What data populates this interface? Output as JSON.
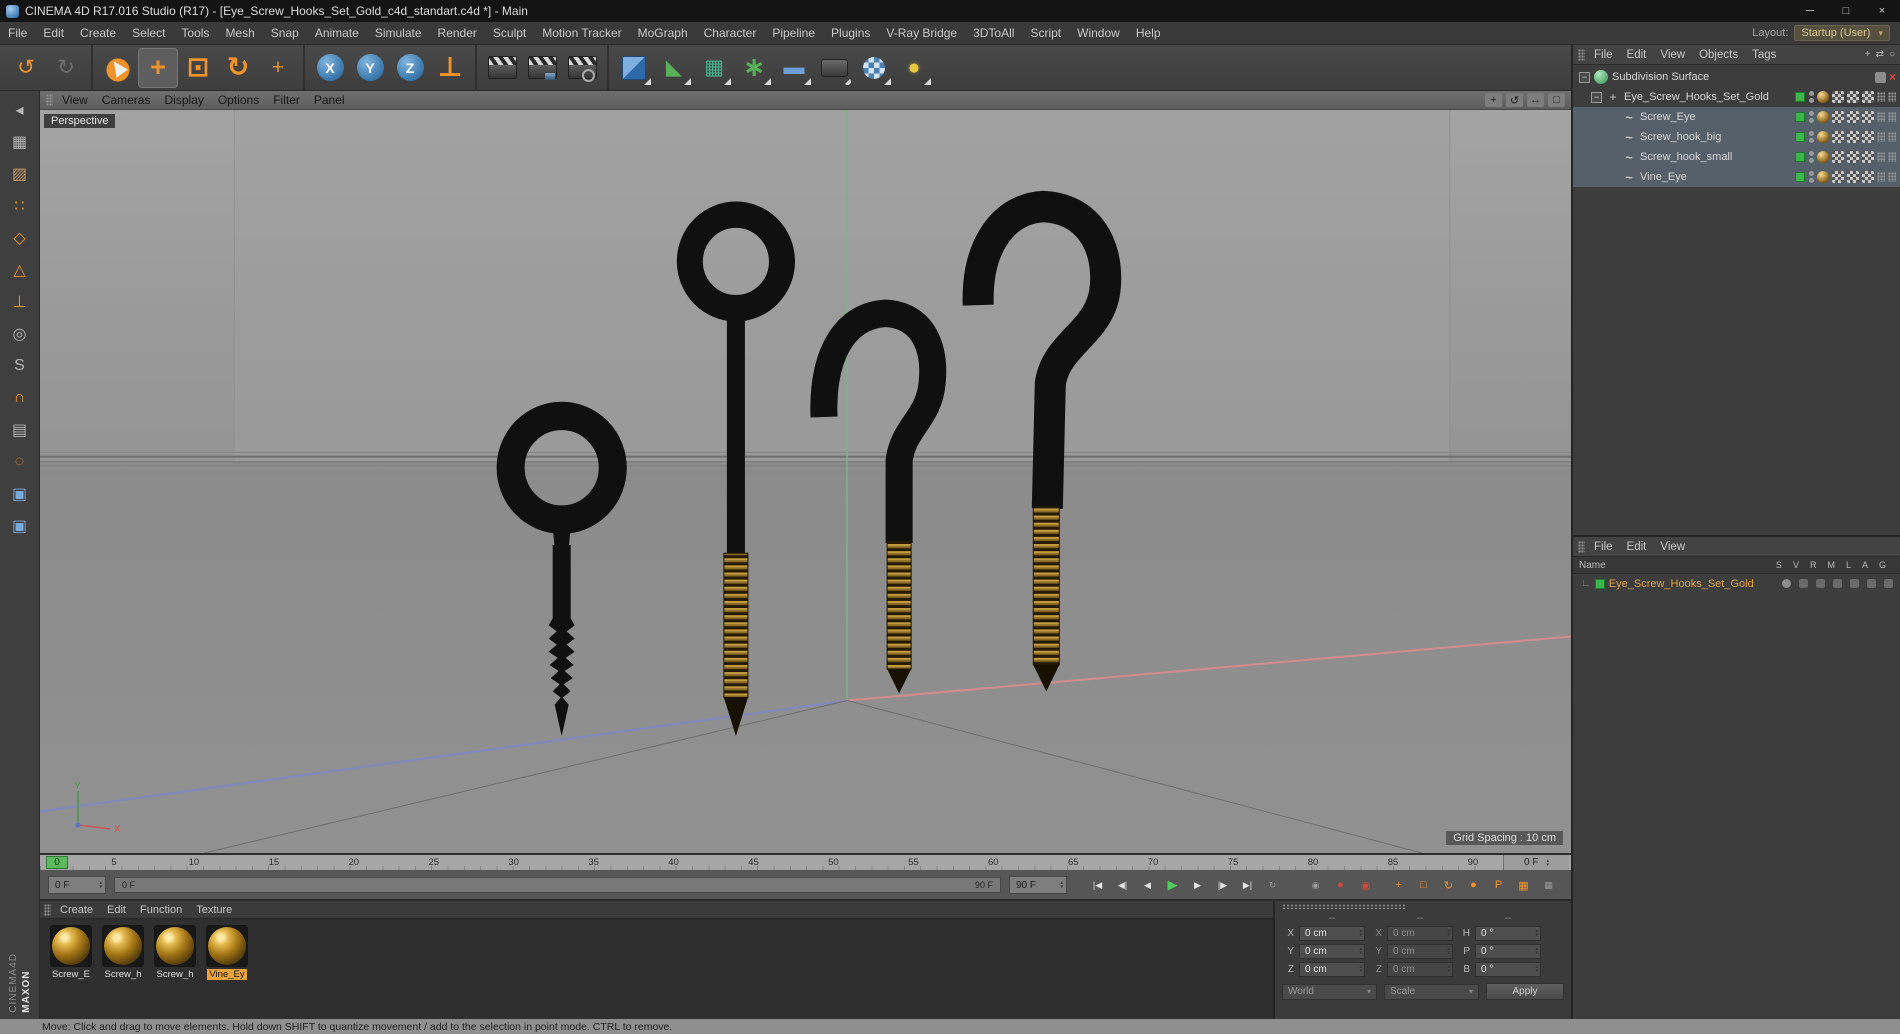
{
  "window": {
    "title": "CINEMA 4D R17.016 Studio (R17) - [Eye_Screw_Hooks_Set_Gold_c4d_standart.c4d *] - Main",
    "minimize": "─",
    "maximize": "□",
    "close": "×"
  },
  "menubar": {
    "items": [
      "File",
      "Edit",
      "Create",
      "Select",
      "Tools",
      "Mesh",
      "Snap",
      "Animate",
      "Simulate",
      "Render",
      "Sculpt",
      "Motion Tracker",
      "MoGraph",
      "Character",
      "Pipeline",
      "Plugins",
      "V-Ray Bridge",
      "3DToAll",
      "Script",
      "Window",
      "Help"
    ],
    "layout_label": "Layout:",
    "layout_value": "Startup (User)"
  },
  "toolbar": {
    "groups": [
      [
        {
          "name": "undo-icon",
          "glyph": "↺",
          "cls": "c-orange"
        },
        {
          "name": "redo-icon",
          "glyph": "↻",
          "cls": "c-dim"
        }
      ],
      [
        {
          "name": "live-selection-icon",
          "cls": "i-cursor"
        },
        {
          "name": "move-tool-icon",
          "glyph": "+",
          "cls": "c-orange xl active"
        },
        {
          "name": "scale-tool-icon",
          "glyph": "⊡",
          "cls": "c-orange xl"
        },
        {
          "name": "rotate-tool-icon",
          "glyph": "↻",
          "cls": "c-orange xl"
        },
        {
          "name": "last-used-tool-icon",
          "glyph": "+",
          "cls": "c-orange"
        }
      ],
      [
        {
          "name": "lock-x-axis-icon",
          "glyph": "X",
          "cls": "axis"
        },
        {
          "name": "lock-y-axis-icon",
          "glyph": "Y",
          "cls": "axis"
        },
        {
          "name": "lock-z-axis-icon",
          "glyph": "Z",
          "cls": "axis"
        },
        {
          "name": "coordinate-system-icon",
          "glyph": "⊥",
          "cls": "c-orange xl"
        }
      ],
      [
        {
          "name": "render-view-icon",
          "cls": "i-clapper"
        },
        {
          "name": "render-picture-viewer-icon",
          "cls": "i-clapper pv"
        },
        {
          "name": "render-settings-icon",
          "cls": "i-clapper set"
        }
      ],
      [
        {
          "name": "add-cube-icon",
          "cls": "i-cube corner"
        },
        {
          "name": "add-spline-icon",
          "glyph": "◣",
          "cls": "c-green corner"
        },
        {
          "name": "add-subdivision-surface-icon",
          "glyph": "▦",
          "cls": "c-teal corner"
        },
        {
          "name": "add-array-icon",
          "glyph": "∗",
          "cls": "c-green corner xl"
        },
        {
          "name": "add-floor-icon",
          "glyph": "▬",
          "cls": "c-blue corner"
        },
        {
          "name": "add-camera-icon",
          "cls": "i-camera corner"
        },
        {
          "name": "add-sky-icon",
          "cls": "i-sky corner"
        },
        {
          "name": "add-light-icon",
          "glyph": "●",
          "cls": "c-yellow corner"
        }
      ]
    ]
  },
  "tool_strip": {
    "tools": [
      {
        "name": "make-editable-icon",
        "glyph": "◂",
        "cls": "g"
      },
      {
        "name": "model-mode-icon",
        "glyph": "▦",
        "cls": "g"
      },
      {
        "name": "texture-mode-icon",
        "glyph": "▨",
        "cls": "brown"
      },
      {
        "name": "points-mode-icon",
        "glyph": "∷",
        "cls": "org"
      },
      {
        "name": "edges-mode-icon",
        "glyph": "◇",
        "cls": "org"
      },
      {
        "name": "polygons-mode-icon",
        "glyph": "△",
        "cls": "org"
      },
      {
        "name": "enable-axis-icon",
        "glyph": "⊥",
        "cls": "org"
      },
      {
        "name": "viewport-solo-icon",
        "glyph": "◎",
        "cls": "g"
      },
      {
        "name": "snap-settings-icon",
        "glyph": "S",
        "cls": "g"
      },
      {
        "name": "snap-toggle-icon",
        "glyph": "∩",
        "cls": "org"
      },
      {
        "name": "workplane-lock-icon",
        "glyph": "▤",
        "cls": "g"
      },
      {
        "name": "quantize-icon",
        "glyph": "◌",
        "cls": "org"
      },
      {
        "name": "python-plugin-icon",
        "glyph": "▣",
        "cls": "blue"
      },
      {
        "name": "plugin-icon",
        "glyph": "▣",
        "cls": "blue"
      }
    ],
    "brand_top": "MAXON",
    "brand_bottom": "CINEMA4D"
  },
  "viewport": {
    "menu": [
      "View",
      "Cameras",
      "Display",
      "Options",
      "Filter",
      "Panel"
    ],
    "nav_icons": [
      {
        "name": "pan-view-icon",
        "glyph": "+"
      },
      {
        "name": "orbit-view-icon",
        "glyph": "↺"
      },
      {
        "name": "zoom-view-icon",
        "glyph": "↔"
      },
      {
        "name": "toggle-panel-icon",
        "glyph": "□"
      }
    ],
    "view_label": "Perspective",
    "grid_spacing": "Grid Spacing : 10 cm",
    "axis_y": "Y",
    "axis_x": "X"
  },
  "timeline": {
    "playhead": "0",
    "marks": [
      "5",
      "10",
      "15",
      "20",
      "25",
      "30",
      "35",
      "40",
      "45",
      "50",
      "55",
      "60",
      "65",
      "70",
      "75",
      "80",
      "85",
      "90"
    ],
    "current_frame": "0 F"
  },
  "transport": {
    "frame_field": "0 F",
    "range_start": "0 F",
    "range_end": "90 F",
    "end_field": "90 F",
    "buttons": [
      {
        "name": "goto-start-button",
        "glyph": "|◀"
      },
      {
        "name": "prev-key-button",
        "glyph": "◀|"
      },
      {
        "name": "prev-frame-button",
        "glyph": "◀"
      },
      {
        "name": "play-button",
        "glyph": "▶",
        "cls": "play"
      },
      {
        "name": "next-frame-button",
        "glyph": "▶"
      },
      {
        "name": "next-key-button",
        "glyph": "|▶"
      },
      {
        "name": "goto-end-button",
        "glyph": "▶|"
      },
      {
        "name": "loop-button",
        "glyph": "↻",
        "cls": "dim"
      }
    ],
    "record_buttons": [
      {
        "name": "keyframe-selection-icon",
        "glyph": "◉",
        "cls": "dim"
      },
      {
        "name": "record-button",
        "glyph": "●",
        "cls": "red"
      },
      {
        "name": "autokey-button",
        "glyph": "◉",
        "cls": "red"
      }
    ],
    "key_buttons": [
      {
        "name": "record-position-icon",
        "glyph": "+",
        "cls": "org"
      },
      {
        "name": "record-scale-icon",
        "glyph": "□",
        "cls": "org"
      },
      {
        "name": "record-rotation-icon",
        "glyph": "↻",
        "cls": "org"
      },
      {
        "name": "record-pla-icon",
        "glyph": "●",
        "cls": "org"
      },
      {
        "name": "record-parameter-icon",
        "glyph": "P",
        "cls": "org"
      },
      {
        "name": "keyframe-presets-icon",
        "glyph": "▦",
        "cls": "org"
      },
      {
        "name": "timeline-layout-icon",
        "glyph": "▦",
        "cls": "dim"
      }
    ]
  },
  "materials": {
    "menu": [
      "Create",
      "Edit",
      "Function",
      "Texture"
    ],
    "items": [
      {
        "label": "Screw_E"
      },
      {
        "label": "Screw_h"
      },
      {
        "label": "Screw_h"
      },
      {
        "label": "Vine_Ey",
        "cls": "selected"
      }
    ]
  },
  "coordinates": {
    "headers": [
      "--",
      "--",
      "--"
    ],
    "rows": [
      {
        "l1": "X",
        "v1": "0 cm",
        "n1": "position-x-field",
        "l2": "X",
        "v2": "0 cm",
        "n2": "size-x-field",
        "l3": "H",
        "v3": "0 °",
        "n3": "rotation-h-field"
      },
      {
        "l1": "Y",
        "v1": "0 cm",
        "n1": "position-y-field",
        "l2": "Y",
        "v2": "0 cm",
        "n2": "size-y-field",
        "l3": "P",
        "v3": "0 °",
        "n3": "rotation-p-field"
      },
      {
        "l1": "Z",
        "v1": "0 cm",
        "n1": "position-z-field",
        "l2": "Z",
        "v2": "0 cm",
        "n2": "size-z-field",
        "l3": "B",
        "v3": "0 °",
        "n3": "rotation-b-field"
      }
    ],
    "mode_dropdown": "World",
    "scale_dropdown": "Scale",
    "apply_button": "Apply"
  },
  "object_manager": {
    "menu": [
      "File",
      "Edit",
      "View",
      "Objects",
      "Tags"
    ],
    "menu_icons": [
      {
        "name": "add-object-icon",
        "glyph": "+"
      },
      {
        "name": "filter-icon",
        "glyph": "⇄"
      },
      {
        "name": "search-icon",
        "glyph": "○"
      }
    ],
    "tree": [
      {
        "label": "Subdivision Surface",
        "cls": "d0 t-gen"
      },
      {
        "label": "Eye_Screw_Hooks_Set_Gold",
        "cls": "d1 t-null"
      },
      {
        "label": "Screw_Eye",
        "cls": "d2 t-spline sel"
      },
      {
        "label": "Screw_hook_big",
        "cls": "d2 t-spline sel"
      },
      {
        "label": "Screw_hook_small",
        "cls": "d2 t-spline sel"
      },
      {
        "label": "Vine_Eye",
        "cls": "d2 t-spline sel"
      }
    ]
  },
  "layer_manager": {
    "menu": [
      "File",
      "Edit",
      "View"
    ],
    "name_header": "Name",
    "columns": [
      "S",
      "V",
      "R",
      "M",
      "L",
      "A",
      "G"
    ],
    "rows": [
      {
        "label": "Eye_Screw_Hooks_Set_Gold"
      }
    ]
  },
  "status_bar": "Move: Click and drag to move elements. Hold down SHIFT to quantize movement / add to the selection in point mode. CTRL to remove.",
  "colors": {
    "accent_orange": "#f0932a",
    "selection_green": "#3cb54a",
    "record_red": "#d5463a",
    "play_green": "#52c95e",
    "material_gold": "#b8860b",
    "viewport_gray": "#979797"
  }
}
